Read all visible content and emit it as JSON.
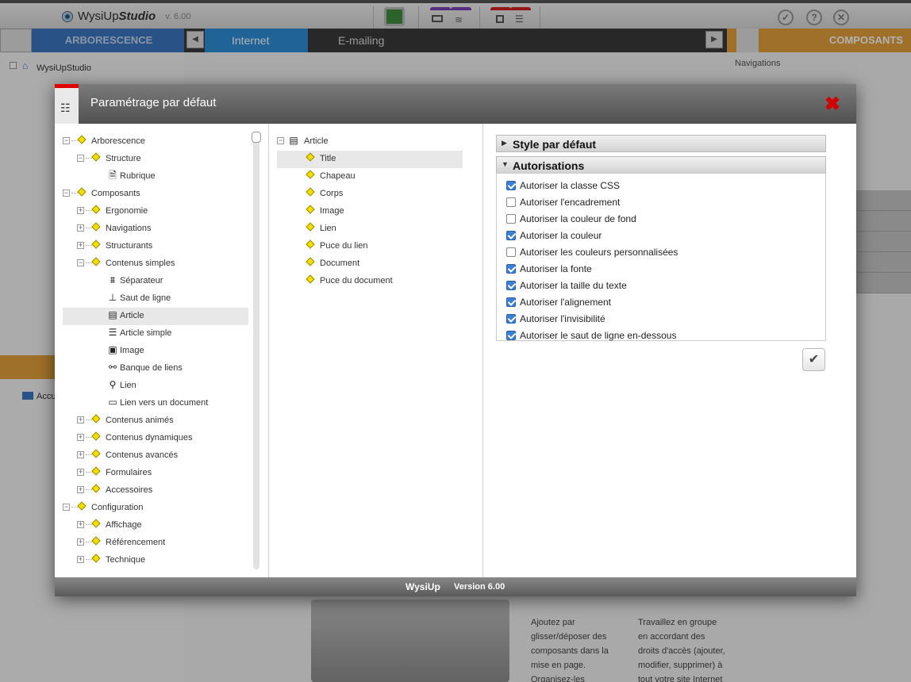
{
  "app": {
    "name": "WysiUp",
    "name_studio": "Studio",
    "version": "v. 6.00"
  },
  "toolbar": {
    "check_icon": "✓",
    "help_icon": "?",
    "close_icon": "✕"
  },
  "left_header": "ARBORESCENCE",
  "tabs": {
    "internet": "Internet",
    "emailing": "E-mailing"
  },
  "right_header": "COMPOSANTS",
  "right_panel": {
    "navigations": "Navigations"
  },
  "bg_tree": {
    "root": "WysiUpStudio",
    "accueil": "Accu"
  },
  "bg_text": {
    "col_a": "Ajoutez par glisser/déposer des composants dans la mise en page. Organisez-les",
    "col_b": "Travaillez en groupe en accordant des droits d'accès (ajouter, modifier, supprimer) à tout votre site Internet"
  },
  "dialog": {
    "title": "Paramétrage par défaut",
    "close_label": "✖",
    "tree": [
      {
        "label": "Arborescence",
        "level": 0,
        "exp": "−",
        "icon": "diamond"
      },
      {
        "label": "Structure",
        "level": 1,
        "exp": "−",
        "icon": "diamond"
      },
      {
        "label": "Rubrique",
        "level": 2,
        "exp": "",
        "icon": "page"
      },
      {
        "label": "Composants",
        "level": 0,
        "exp": "−",
        "icon": "diamond"
      },
      {
        "label": "Ergonomie",
        "level": 1,
        "exp": "+",
        "icon": "diamond"
      },
      {
        "label": "Navigations",
        "level": 1,
        "exp": "+",
        "icon": "diamond"
      },
      {
        "label": "Structurants",
        "level": 1,
        "exp": "+",
        "icon": "diamond"
      },
      {
        "label": "Contenus simples",
        "level": 1,
        "exp": "−",
        "icon": "diamond"
      },
      {
        "label": "Séparateur",
        "level": 2,
        "exp": "",
        "icon": "separator"
      },
      {
        "label": "Saut de ligne",
        "level": 2,
        "exp": "",
        "icon": "linebreak"
      },
      {
        "label": "Article",
        "level": 2,
        "exp": "",
        "icon": "article",
        "selected": true
      },
      {
        "label": "Article simple",
        "level": 2,
        "exp": "",
        "icon": "article-simple"
      },
      {
        "label": "Image",
        "level": 2,
        "exp": "",
        "icon": "image"
      },
      {
        "label": "Banque de liens",
        "level": 2,
        "exp": "",
        "icon": "link-bank"
      },
      {
        "label": "Lien",
        "level": 2,
        "exp": "",
        "icon": "link"
      },
      {
        "label": "Lien vers un document",
        "level": 2,
        "exp": "",
        "icon": "document"
      },
      {
        "label": "Contenus animés",
        "level": 1,
        "exp": "+",
        "icon": "diamond"
      },
      {
        "label": "Contenus dynamiques",
        "level": 1,
        "exp": "+",
        "icon": "diamond"
      },
      {
        "label": "Contenus avancés",
        "level": 1,
        "exp": "+",
        "icon": "diamond"
      },
      {
        "label": "Formulaires",
        "level": 1,
        "exp": "+",
        "icon": "diamond"
      },
      {
        "label": "Accessoires",
        "level": 1,
        "exp": "+",
        "icon": "diamond"
      },
      {
        "label": "Configuration",
        "level": 0,
        "exp": "−",
        "icon": "diamond"
      },
      {
        "label": "Affichage",
        "level": 1,
        "exp": "+",
        "icon": "diamond"
      },
      {
        "label": "Référencement",
        "level": 1,
        "exp": "+",
        "icon": "diamond"
      },
      {
        "label": "Technique",
        "level": 1,
        "exp": "+",
        "icon": "diamond"
      }
    ],
    "article_tree": {
      "root": "Article",
      "items": [
        "Title",
        "Chapeau",
        "Corps",
        "Image",
        "Lien",
        "Puce du lien",
        "Document",
        "Puce du document"
      ],
      "selected_index": 0
    },
    "sections": {
      "style": "Style par défaut",
      "autorisations": "Autorisations"
    },
    "permissions": [
      {
        "label": "Autoriser la classe CSS",
        "checked": true
      },
      {
        "label": "Autoriser l'encadrement",
        "checked": false
      },
      {
        "label": "Autoriser la couleur de fond",
        "checked": false
      },
      {
        "label": "Autoriser la couleur",
        "checked": true
      },
      {
        "label": "Autoriser les couleurs personnalisées",
        "checked": false
      },
      {
        "label": "Autoriser la fonte",
        "checked": true
      },
      {
        "label": "Autoriser la taille du texte",
        "checked": true
      },
      {
        "label": "Autoriser l'alignement",
        "checked": true
      },
      {
        "label": "Autoriser l'invisibilité",
        "checked": true
      },
      {
        "label": "Autoriser le saut de ligne en-dessous",
        "checked": true
      }
    ],
    "footer": {
      "name": "WysiUp",
      "version": "Version 6.00"
    }
  },
  "colors": {
    "accent_blue": "#2f8fd9",
    "accent_orange": "#e2a13c",
    "close_red": "#d40000",
    "check_blue": "#3b7fd6"
  }
}
